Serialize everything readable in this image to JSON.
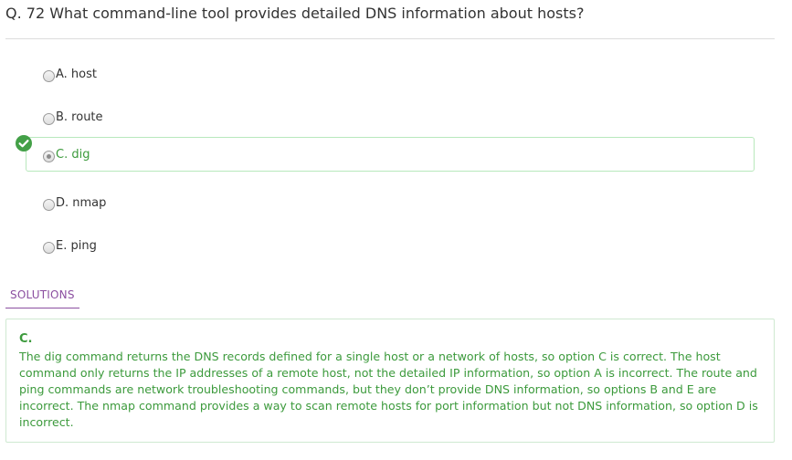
{
  "question": {
    "text": "Q. 72  What command-line tool provides detailed DNS information about hosts?"
  },
  "options": [
    {
      "label": "A. host",
      "selected": false,
      "correct": false
    },
    {
      "label": "B. route",
      "selected": false,
      "correct": false
    },
    {
      "label": "C. dig",
      "selected": true,
      "correct": true
    },
    {
      "label": "D. nmap",
      "selected": false,
      "correct": false
    },
    {
      "label": "E. ping",
      "selected": false,
      "correct": false
    }
  ],
  "solutions": {
    "tab_label": "SOLUTIONS",
    "answer": "C.",
    "explanation": "The dig command returns the DNS records defined for a single host or a network of hosts, so option C is correct. The host command only returns the IP addresses of a remote host, not the detailed IP information, so option A is incorrect. The route and ping commands are network troubleshooting commands, but they don’t provide DNS information, so options B and E are incorrect. The nmap command provides a way to scan remote hosts for port information but not DNS information, so option D is incorrect."
  },
  "colors": {
    "correct_green": "#3c9a3c",
    "check_icon": "#43a047",
    "solutions_tab": "#8b4fa0"
  },
  "icons": {
    "correct_marker": "check-circle-icon"
  }
}
